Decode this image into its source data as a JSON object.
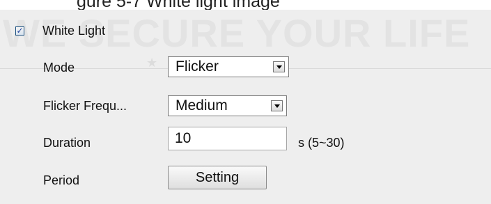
{
  "caption": "gure 5-7 White light image",
  "watermark": {
    "text": "WE SECURE YOUR LIFE",
    "stars": "★ ★ ★ ★"
  },
  "white_light": {
    "checked": true,
    "label": "White Light"
  },
  "fields": {
    "mode": {
      "label": "Mode",
      "value": "Flicker"
    },
    "flicker_frequency": {
      "label": "Flicker Frequ...",
      "value": "Medium"
    },
    "duration": {
      "label": "Duration",
      "value": "10",
      "unit": "s (5~30)"
    },
    "period": {
      "label": "Period",
      "button": "Setting"
    }
  },
  "colors": {
    "panel_bg": "#eeeeee",
    "checkbox_border": "#1c5180"
  }
}
